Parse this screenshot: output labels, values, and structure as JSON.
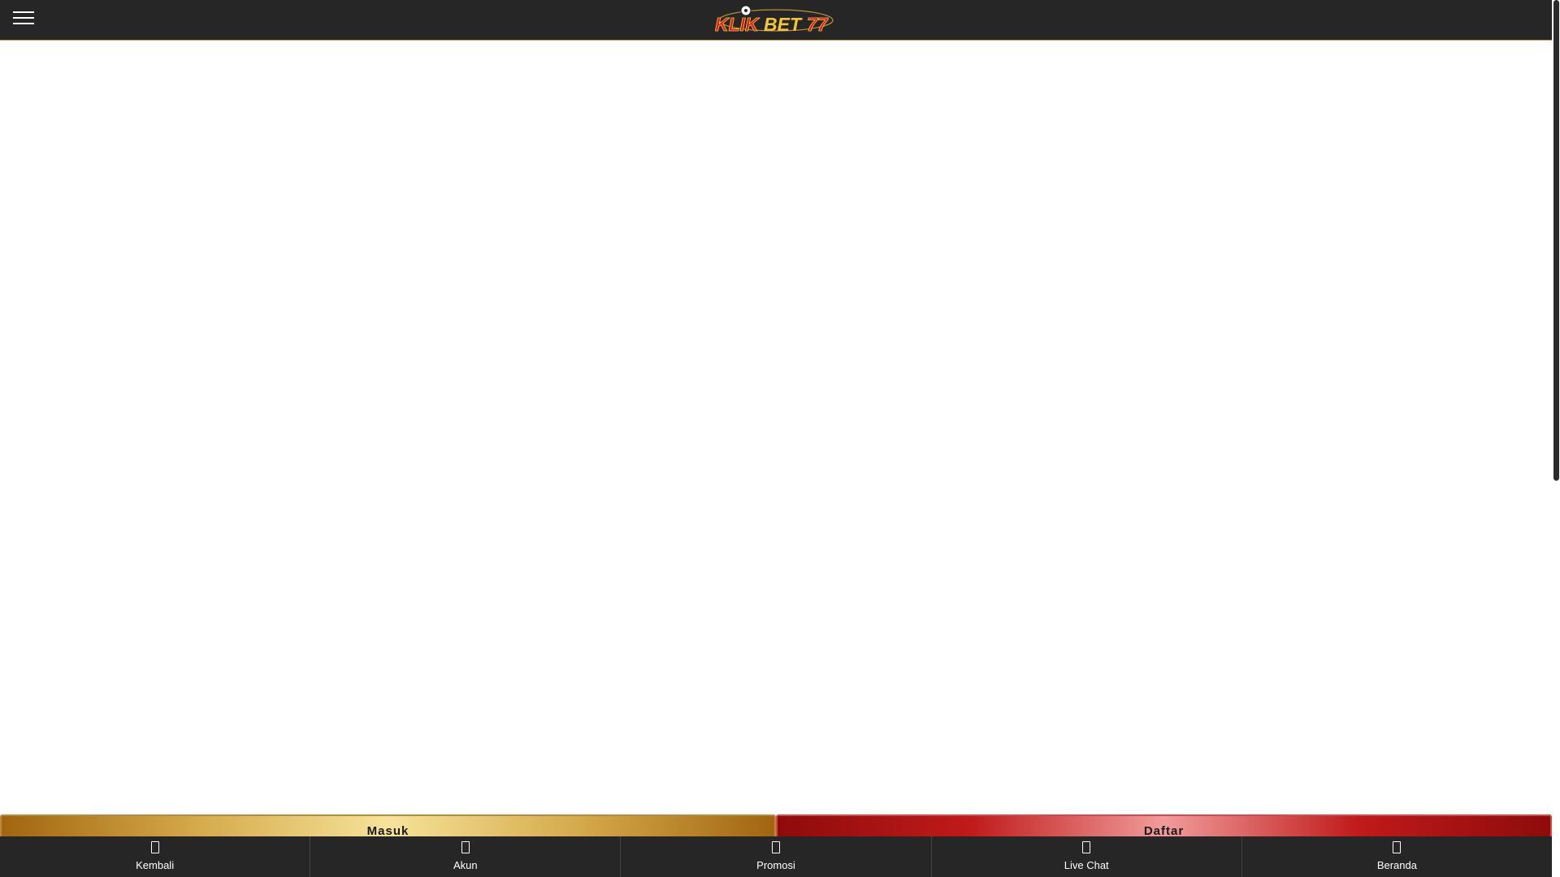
{
  "header": {
    "logo_text": "KLIKBET77",
    "menu_icon": "hamburger-menu-icon"
  },
  "auth": {
    "login_label": "Masuk",
    "register_label": "Daftar"
  },
  "bottom_nav": {
    "items": [
      {
        "label": "Kembali",
        "icon": "back-icon"
      },
      {
        "label": "Akun",
        "icon": "account-icon"
      },
      {
        "label": "Promosi",
        "icon": "promotion-icon"
      },
      {
        "label": "Live Chat",
        "icon": "chat-icon"
      },
      {
        "label": "Beranda",
        "icon": "home-icon"
      }
    ]
  },
  "colors": {
    "header_bg": "#262626",
    "gold": "#d4a94a",
    "red": "#c11a1a",
    "logo_red": "#e0191f",
    "logo_gold": "#f2c53d"
  }
}
